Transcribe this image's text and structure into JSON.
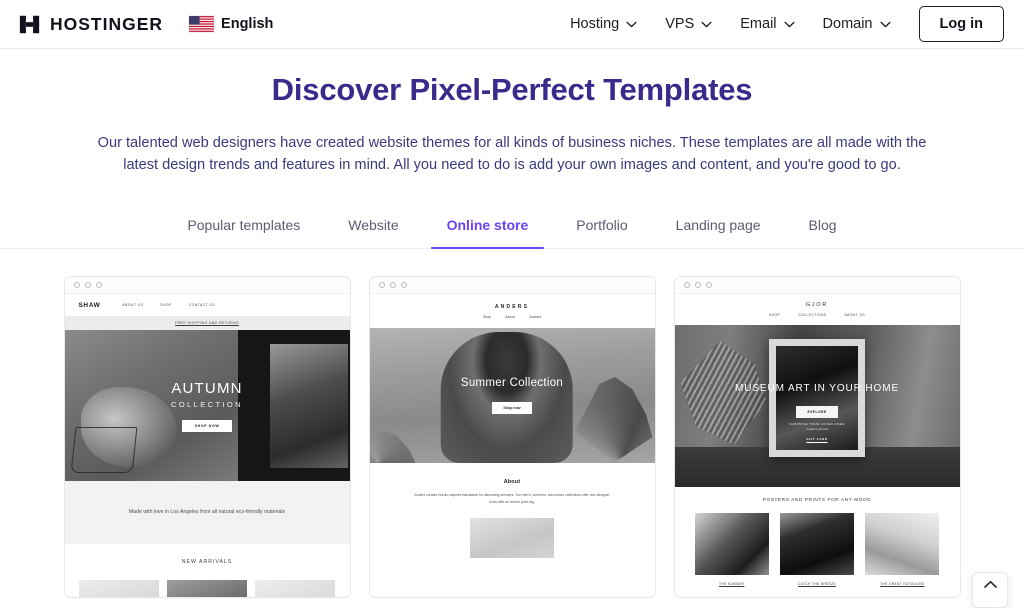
{
  "header": {
    "brand_name": "HOSTINGER",
    "language": "English",
    "nav": [
      {
        "label": "Hosting",
        "has_caret": true
      },
      {
        "label": "VPS",
        "has_caret": true
      },
      {
        "label": "Email",
        "has_caret": true
      },
      {
        "label": "Domain",
        "has_caret": true
      }
    ],
    "login_label": "Log in"
  },
  "hero": {
    "title": "Discover Pixel-Perfect Templates",
    "description": "Our talented web designers have created website themes for all kinds of business niches. These templates are all made with the latest design trends and features in mind. All you need to do is add your own images and content, and you're good to go.",
    "title_color": "#3b2a8c",
    "text_color": "#3b3a7c"
  },
  "tabs": {
    "active": "Online store",
    "accent_color": "#6c42f5",
    "items": [
      {
        "label": "Popular templates"
      },
      {
        "label": "Website"
      },
      {
        "label": "Online store"
      },
      {
        "label": "Portfolio"
      },
      {
        "label": "Landing page"
      },
      {
        "label": "Blog"
      }
    ]
  },
  "templates": [
    {
      "id": "shaw",
      "logo": "SHAW",
      "nav": [
        "ABOUT US",
        "SHOP",
        "CONTACT US"
      ],
      "announcement": "FREE SHIPPING AND RETURNS",
      "hero_title": "AUTUMN",
      "hero_subtitle": "COLLECTION",
      "hero_button": "SHOP NOW",
      "tagline": "Made with love in Los Angeles from all natural eco-friendly materials",
      "section_title": "NEW ARRIVALS"
    },
    {
      "id": "anders",
      "logo": "ANDERS",
      "nav": [
        "Shop",
        "About",
        "Contact"
      ],
      "hero_title": "Summer Collection",
      "hero_button": "Shop now",
      "section_title": "About",
      "section_body": "Anders creates Nordic-inspired sweatwear for discerning dressers. Our men's, women's, and unisex collections offer chic designer looks with an honest price tag."
    },
    {
      "id": "gjor",
      "logo": "GJOR",
      "nav": [
        "SHOP",
        "COLLECTIONS",
        "ABOUT US"
      ],
      "hero_title": "MUSEUM ART IN YOUR HOME",
      "hero_button": "EXPLORE",
      "frame_line1": "SURPRISE YOUR LOVED ONES",
      "frame_line2": "Traditions gift card",
      "frame_link": "GIFT CARD",
      "section_title": "POSTERS AND PRINTS FOR ANY MOOD",
      "gallery": [
        {
          "caption": "THE SUMMER"
        },
        {
          "caption": "CATCH THE BREEZE"
        },
        {
          "caption": "THE GREAT OUTDOORS"
        }
      ]
    }
  ]
}
